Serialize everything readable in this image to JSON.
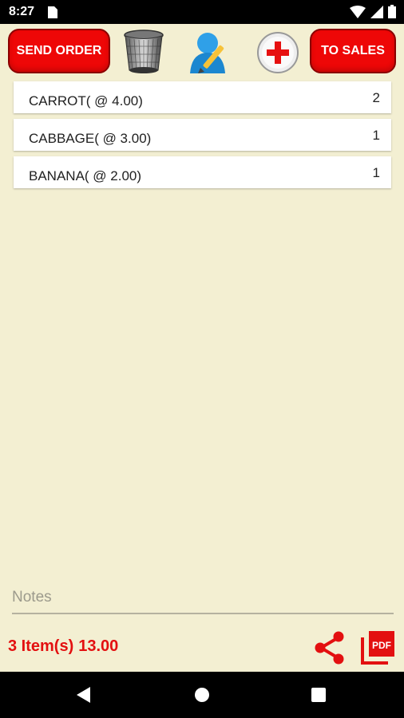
{
  "status_bar": {
    "time": "8:27",
    "icons": [
      "sim-card-icon",
      "wifi-icon",
      "signal-icon",
      "battery-icon"
    ]
  },
  "toolbar": {
    "send_order_label": "SEND ORDER",
    "to_sales_label": "TO SALES",
    "icons": [
      "trash-icon",
      "customer-edit-icon",
      "add-icon"
    ]
  },
  "order_items": [
    {
      "name": "CARROT( @ 4.00)",
      "qty": "2"
    },
    {
      "name": "CABBAGE( @ 3.00)",
      "qty": "1"
    },
    {
      "name": "BANANA( @ 2.00)",
      "qty": "1"
    }
  ],
  "notes": {
    "placeholder": "Notes",
    "value": ""
  },
  "summary": {
    "items_label": "3 Item(s)",
    "total": "13.00"
  },
  "footer_icons": [
    "share-icon",
    "pdf-icon"
  ],
  "colors": {
    "accent": "#ee0707",
    "background": "#f3efd2",
    "text_accent": "#e31010"
  },
  "nav_bar": [
    "back-icon",
    "home-icon",
    "recent-apps-icon"
  ]
}
